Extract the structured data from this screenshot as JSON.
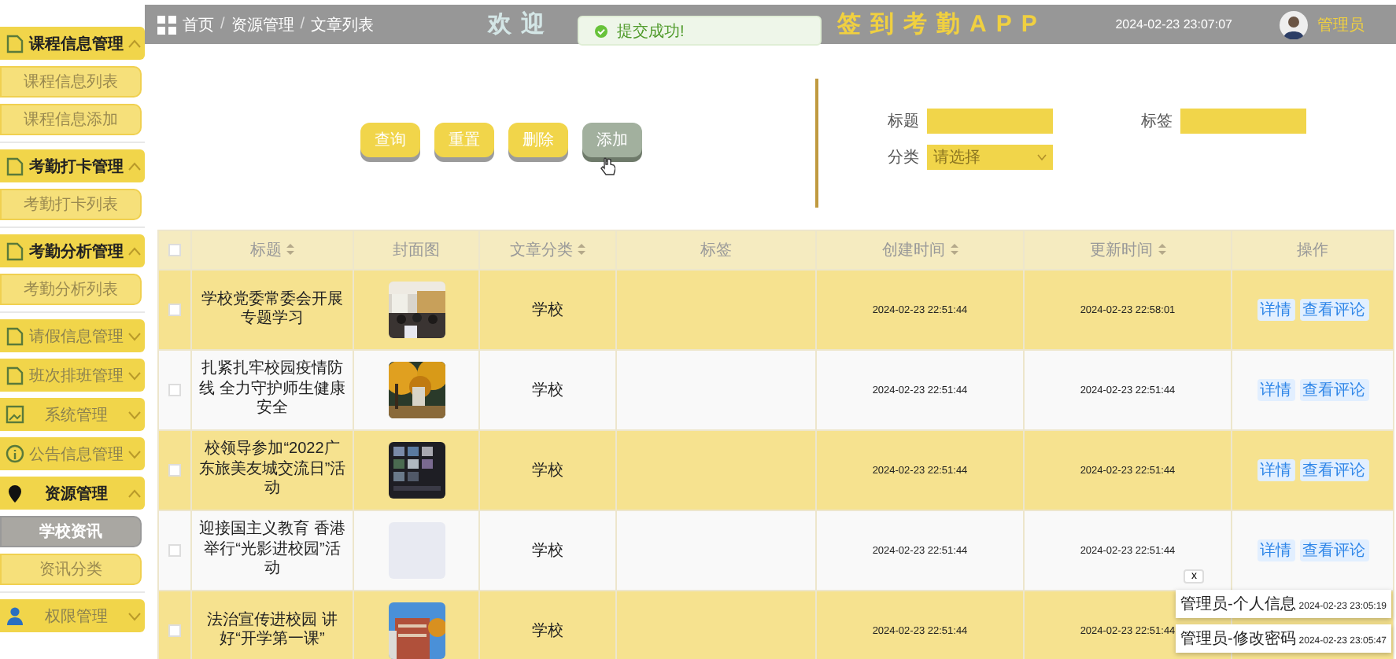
{
  "sidebar": {
    "items": [
      {
        "label": "课程信息管理",
        "expanded": true,
        "children": [
          {
            "label": "课程信息列表",
            "selected": false
          },
          {
            "label": "课程信息添加",
            "selected": false
          }
        ]
      },
      {
        "label": "考勤打卡管理",
        "expanded": true,
        "children": [
          {
            "label": "考勤打卡列表",
            "selected": false
          }
        ]
      },
      {
        "label": "考勤分析管理",
        "expanded": true,
        "children": [
          {
            "label": "考勤分析列表",
            "selected": false
          }
        ]
      },
      {
        "label": "请假信息管理",
        "expanded": false
      },
      {
        "label": "班次排班管理",
        "expanded": false
      },
      {
        "label": "系统管理",
        "expanded": false
      },
      {
        "label": "公告信息管理",
        "expanded": false
      },
      {
        "label": "资源管理",
        "expanded": true,
        "children": [
          {
            "label": "学校资讯",
            "selected": true
          },
          {
            "label": "资讯分类",
            "selected": false
          }
        ]
      },
      {
        "label": "权限管理",
        "expanded": false
      }
    ]
  },
  "header": {
    "breadcrumb": [
      "首页",
      "资源管理",
      "文章列表"
    ],
    "separator": "/",
    "title_start": "欢迎",
    "title_end": "签到考勤APP",
    "datetime": "2024-02-23 23:07:07",
    "user": "管理员"
  },
  "toast": {
    "message": "提交成功!"
  },
  "actions": [
    {
      "label": "查询",
      "kind": "primary"
    },
    {
      "label": "重置",
      "kind": "primary"
    },
    {
      "label": "删除",
      "kind": "primary"
    },
    {
      "label": "添加",
      "kind": "hover"
    }
  ],
  "filters": [
    {
      "label": "标题",
      "kind": "input"
    },
    {
      "label": "标签",
      "kind": "input"
    },
    {
      "label": "分类",
      "kind": "select",
      "placeholder": "请选择"
    }
  ],
  "table": {
    "columns": [
      {
        "label": "标题",
        "sortable": true
      },
      {
        "label": "封面图",
        "sortable": false
      },
      {
        "label": "文章分类",
        "sortable": true
      },
      {
        "label": "标签",
        "sortable": false
      },
      {
        "label": "创建时间",
        "sortable": true
      },
      {
        "label": "更新时间",
        "sortable": true
      },
      {
        "label": "操作",
        "sortable": false
      }
    ],
    "select_all": {
      "checked": false
    },
    "rows": [
      {
        "checked": false,
        "title": "学校党委常委会开展专题学习",
        "cover": true,
        "category": "学校",
        "created": "2024-02-23 22:51:44",
        "updated": "2024-02-23 22:58:01",
        "buttons": [
          "详情",
          "查看评论"
        ]
      },
      {
        "checked": false,
        "title": "扎紧扎牢校园疫情防线 全力守护师生健康安全",
        "cover": true,
        "category": "学校",
        "created": "2024-02-23 22:51:44",
        "updated": "2024-02-23 22:51:44",
        "buttons": [
          "详情",
          "查看评论"
        ]
      },
      {
        "checked": false,
        "title": "校领导参加“2022广东旅美友城交流日”活动",
        "cover": true,
        "category": "学校",
        "created": "2024-02-23 22:51:44",
        "updated": "2024-02-23 22:51:44",
        "buttons": [
          "详情",
          "查看评论"
        ]
      },
      {
        "checked": false,
        "title": "迎接国主义教育 香港举行“光影进校园”活动",
        "cover": false,
        "category": "学校",
        "created": "2024-02-23 22:51:44",
        "updated": "2024-02-23 22:51:44",
        "buttons": [
          "详情",
          "查看评论"
        ]
      },
      {
        "checked": false,
        "title": "法治宣传进校园 讲好“开学第一课”",
        "cover": true,
        "category": "学校",
        "created": "2024-02-23 22:51:44",
        "updated": "2024-02-23 22:51:44"
      }
    ]
  },
  "notifications": {
    "close": "x",
    "items": [
      {
        "source": "管理员-个人信息",
        "time": "2024-02-23 23:05:19"
      },
      {
        "source": "管理员-修改密码",
        "time": "2024-02-23 23:05:47"
      }
    ]
  }
}
